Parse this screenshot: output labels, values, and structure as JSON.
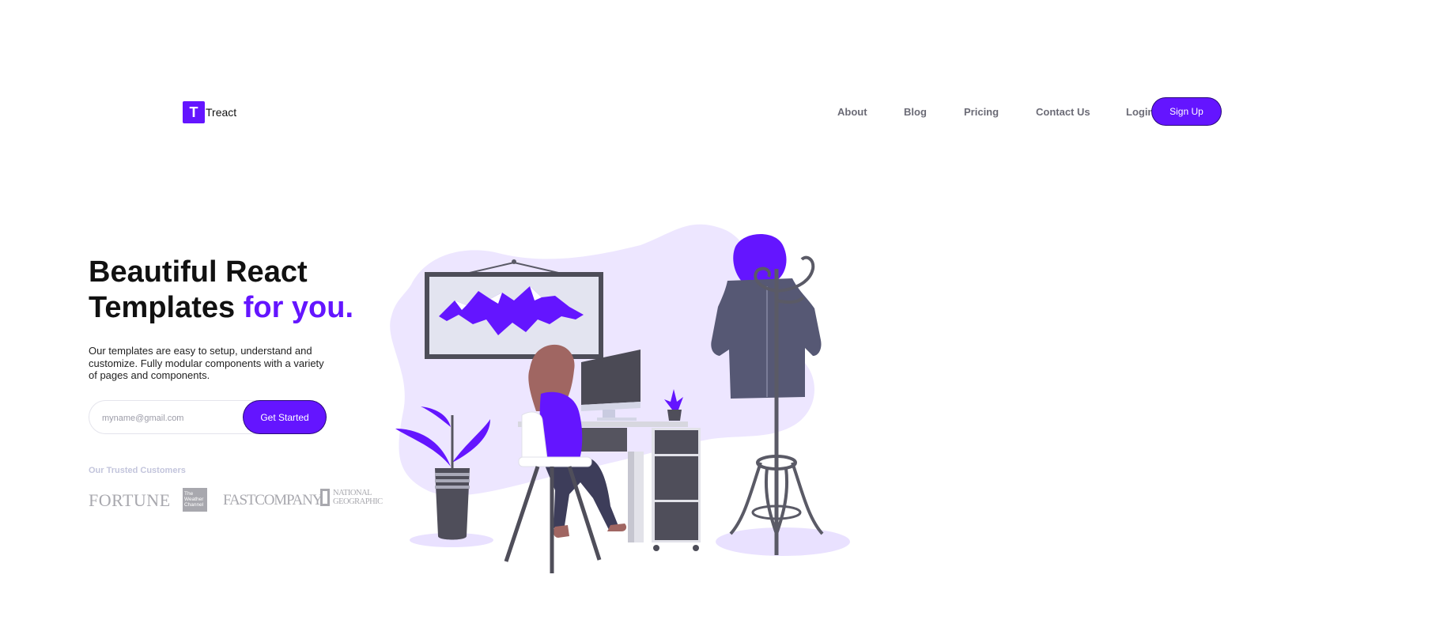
{
  "brand": {
    "mark": "T",
    "name": "Treact"
  },
  "nav": {
    "links": [
      "About",
      "Blog",
      "Pricing",
      "Contact Us",
      "Login"
    ],
    "signup_label": "Sign Up"
  },
  "hero": {
    "title_line1": "Beautiful React",
    "title_line2": "Templates",
    "title_accent": "for you.",
    "description": "Our templates are easy to setup, understand and customize. Fully modular components with a variety of pages and components.",
    "email_placeholder": "myname@gmail.com",
    "cta_label": "Get Started"
  },
  "customers": {
    "label": "Our Trusted Customers",
    "logos": {
      "fortune": "FORTUNE",
      "weather_channel": [
        "The",
        "Weather",
        "Channel"
      ],
      "fast_company": "FASTCOMPANY",
      "national_geographic": [
        "NATIONAL",
        "GEOGRAPHIC"
      ]
    }
  },
  "colors": {
    "accent": "#6415ff",
    "nav_text": "#6b6b76",
    "muted_label": "#c3c5dc",
    "logo_gray": "#a8a8ae",
    "blob": "#ede6ff"
  },
  "icons": [
    "logo-mark-icon",
    "hero-illustration"
  ]
}
